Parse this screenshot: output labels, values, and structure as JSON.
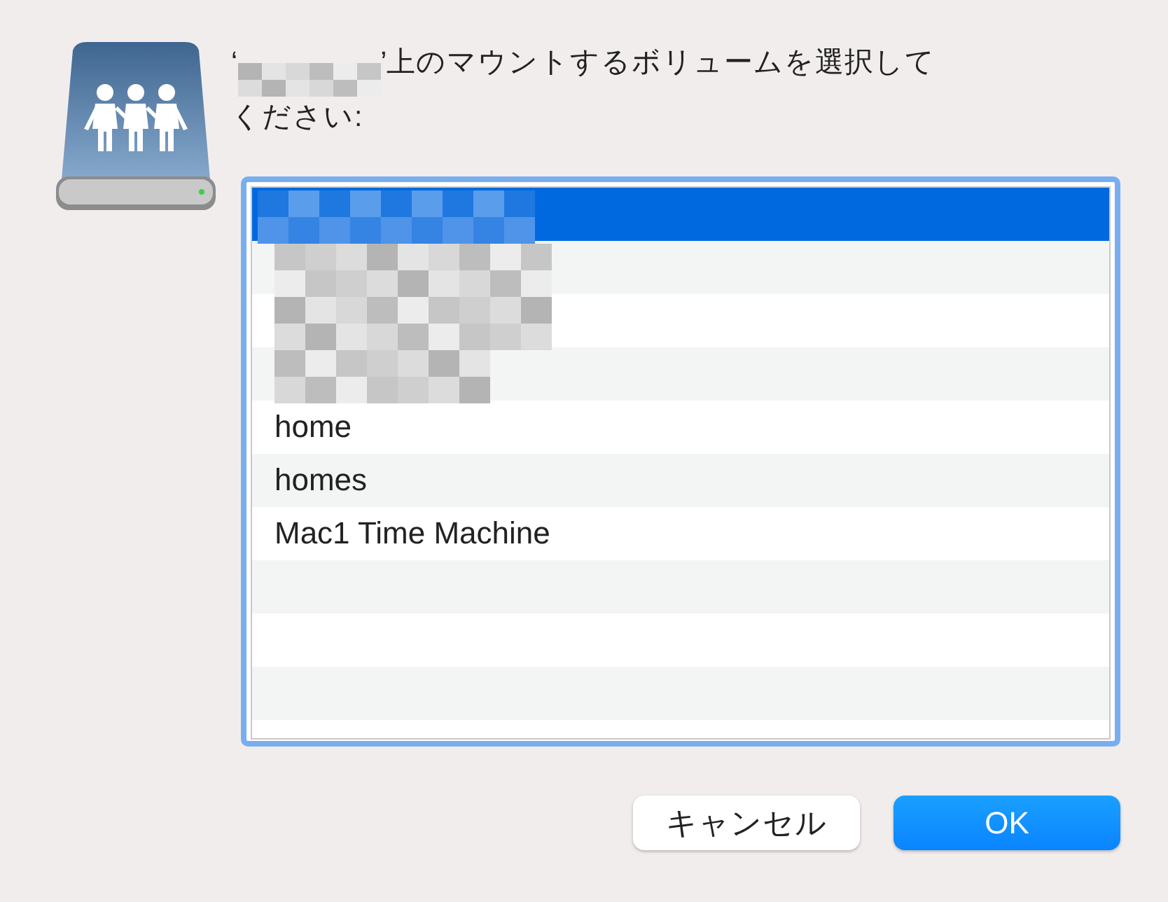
{
  "prompt": {
    "quote_open": "‘",
    "redacted": true,
    "rest": "’上のマウントするボリュームを選択してください:"
  },
  "volumes": [
    {
      "redacted": true,
      "selected": true
    },
    {
      "redacted": true,
      "selected": false
    },
    {
      "redacted": true,
      "selected": false
    },
    {
      "redacted": true,
      "selected": false
    },
    {
      "name": "home",
      "selected": false
    },
    {
      "name": "homes",
      "selected": false
    },
    {
      "name": "Mac1 Time Machine",
      "selected": false
    }
  ],
  "buttons": [
    {
      "label": "キャンセル",
      "kind": "secondary"
    },
    {
      "label": "OK",
      "kind": "primary"
    }
  ]
}
